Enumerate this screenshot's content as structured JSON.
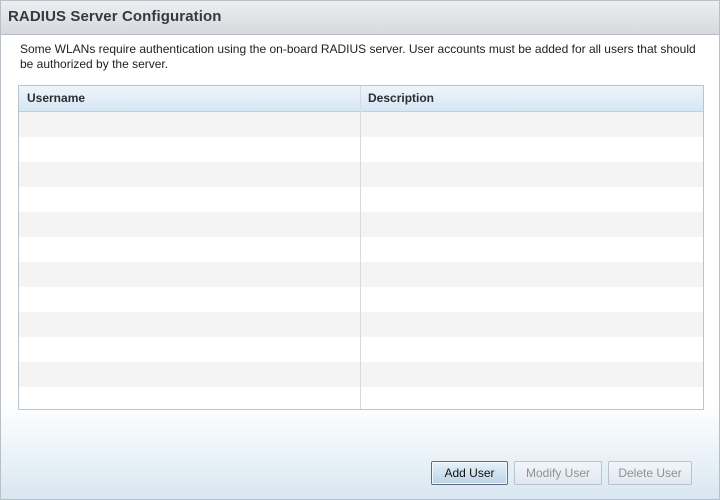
{
  "title": "RADIUS Server Configuration",
  "description": "Some WLANs require authentication using the on-board RADIUS server.  User accounts must be added for all users that should be authorized by the server.",
  "table": {
    "columns": [
      "Username",
      "Description"
    ],
    "rows": []
  },
  "buttons": {
    "add": "Add User",
    "modify": "Modify User",
    "delete": "Delete User"
  }
}
